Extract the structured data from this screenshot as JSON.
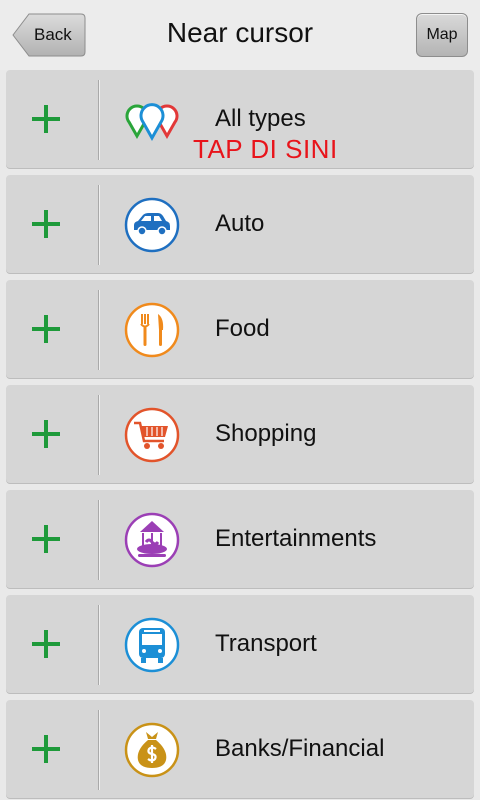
{
  "header": {
    "back_label": "Back",
    "title": "Near cursor",
    "map_label": "Map"
  },
  "colors": {
    "plus": "#1e9a3a",
    "annotation": "#e8141b",
    "auto": "#1f6fc0",
    "food": "#f08a1c",
    "shopping": "#e2542b",
    "entertainments": "#9b3fb5",
    "transport": "#1c8fd6",
    "banks": "#c99217"
  },
  "categories": [
    {
      "label": "All types",
      "icon": "map-pins-icon",
      "annotation": "TAP DI SINI"
    },
    {
      "label": "Auto",
      "icon": "car-icon"
    },
    {
      "label": "Food",
      "icon": "fork-knife-icon"
    },
    {
      "label": "Shopping",
      "icon": "shopping-cart-icon"
    },
    {
      "label": "Entertainments",
      "icon": "carousel-icon"
    },
    {
      "label": "Transport",
      "icon": "bus-icon"
    },
    {
      "label": "Banks/Financial",
      "icon": "money-bag-icon"
    }
  ]
}
